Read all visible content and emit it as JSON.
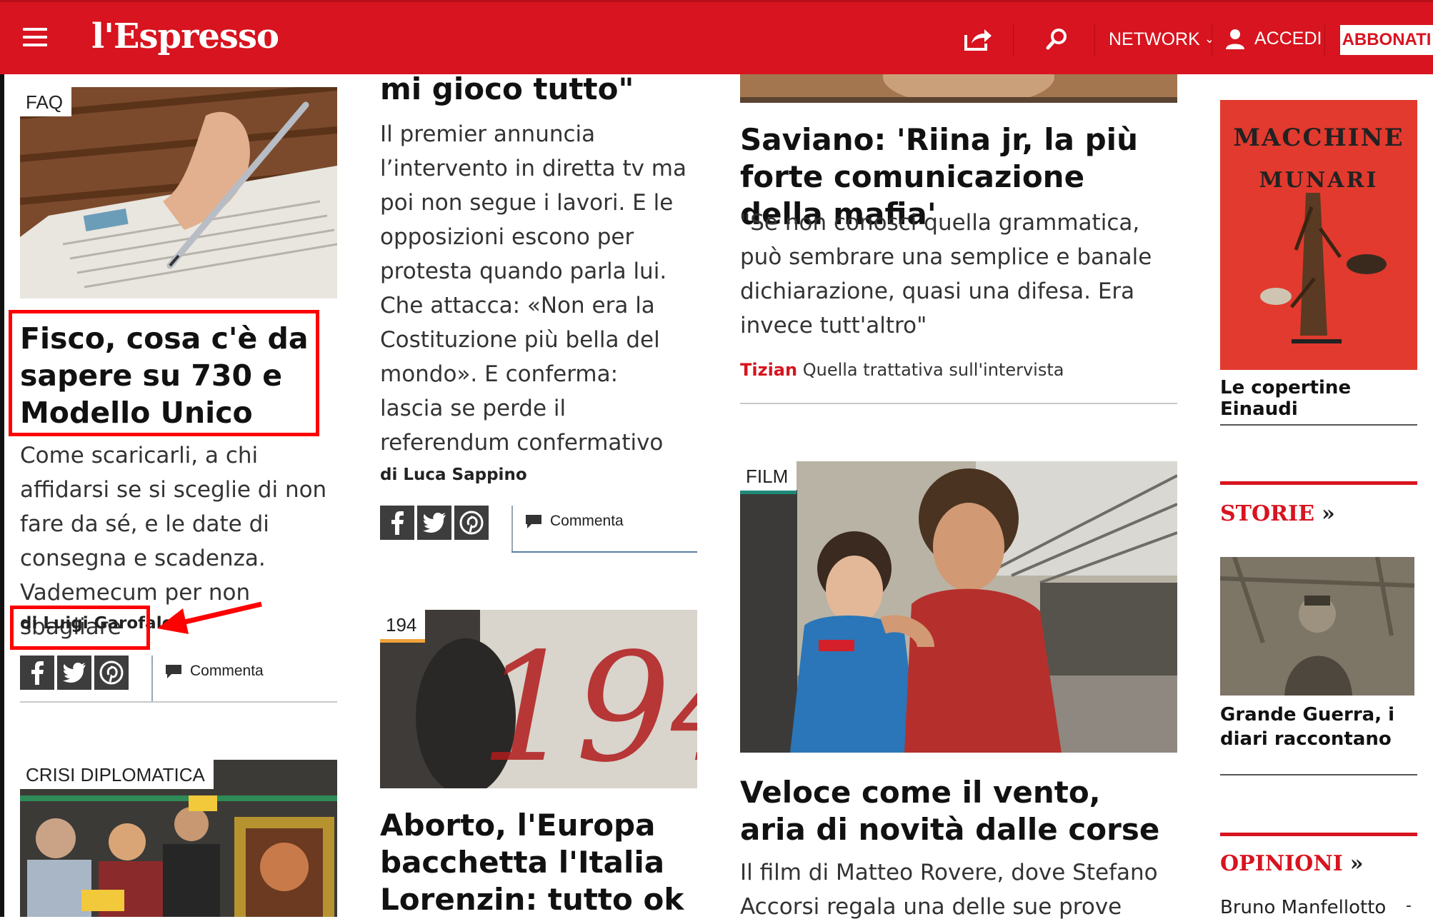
{
  "header": {
    "logo": "l'Espresso",
    "network_label": "NETWORK",
    "accedi_label": "ACCEDI",
    "abbonati_label": "ABBONATI",
    "brand_color": "#d7141f"
  },
  "col1": {
    "faq_tag": "FAQ",
    "article1_title": "Fisco, cosa c'è da sapere su 730 e Modello Unico",
    "article1_body": "Come scaricarli, a chi affidarsi se si sceglie di non fare da sé, e le date di consegna e scadenza. Vademecum per non sbagliare",
    "article1_byline": "di Luigi Garofalo",
    "commenta": "Commenta",
    "crisi_tag": "CRISI DIPLOMATICA"
  },
  "col2": {
    "article_title_tail": "mi gioco tutto\"",
    "article_body": "Il premier annuncia l’intervento in diretta tv ma poi non segue i lavori. E le opposizioni escono per protesta quando parla lui. Che attacca: «Non era la Costituzione più bella del mondo». E conferma: lascia se perde il referendum confermativo",
    "article_byline": "di Luca Sappino",
    "commenta": "Commenta",
    "tag_194": "194",
    "article2_title": "Aborto, l'Europa bacchetta l'Italia Lorenzin: tutto ok"
  },
  "col3": {
    "saviano_title": "Saviano: 'Riina jr, la più forte comunicazione della mafia'",
    "saviano_body": "\"Se non conosci quella grammatica, può sembrare una semplice e banale dichiarazione, quasi una difesa. Era invece tutt'altro\"",
    "related_author": "Tizian",
    "related_text": "Quella trattativa sull'intervista",
    "film_tag": "FILM",
    "film_title": "Veloce come il vento, aria di novità dalle corse",
    "film_body": "Il film di Matteo Rovere, dove Stefano Accorsi regala una delle sue prove"
  },
  "col4": {
    "book_caption": "Le copertine Einaudi",
    "storie_title": "STORIE",
    "storie_raquo": "»",
    "storie_caption": "Grande Guerra, i diari raccontano",
    "opinioni_title": "OPINIONI",
    "opinioni_raquo": "»",
    "opinioni_author": "Bruno Manfellotto",
    "opinioni_dash": "-"
  },
  "book_cover": {
    "line1": "MACCHINE",
    "line2": "MUNARI"
  },
  "photo_194_text": "194"
}
